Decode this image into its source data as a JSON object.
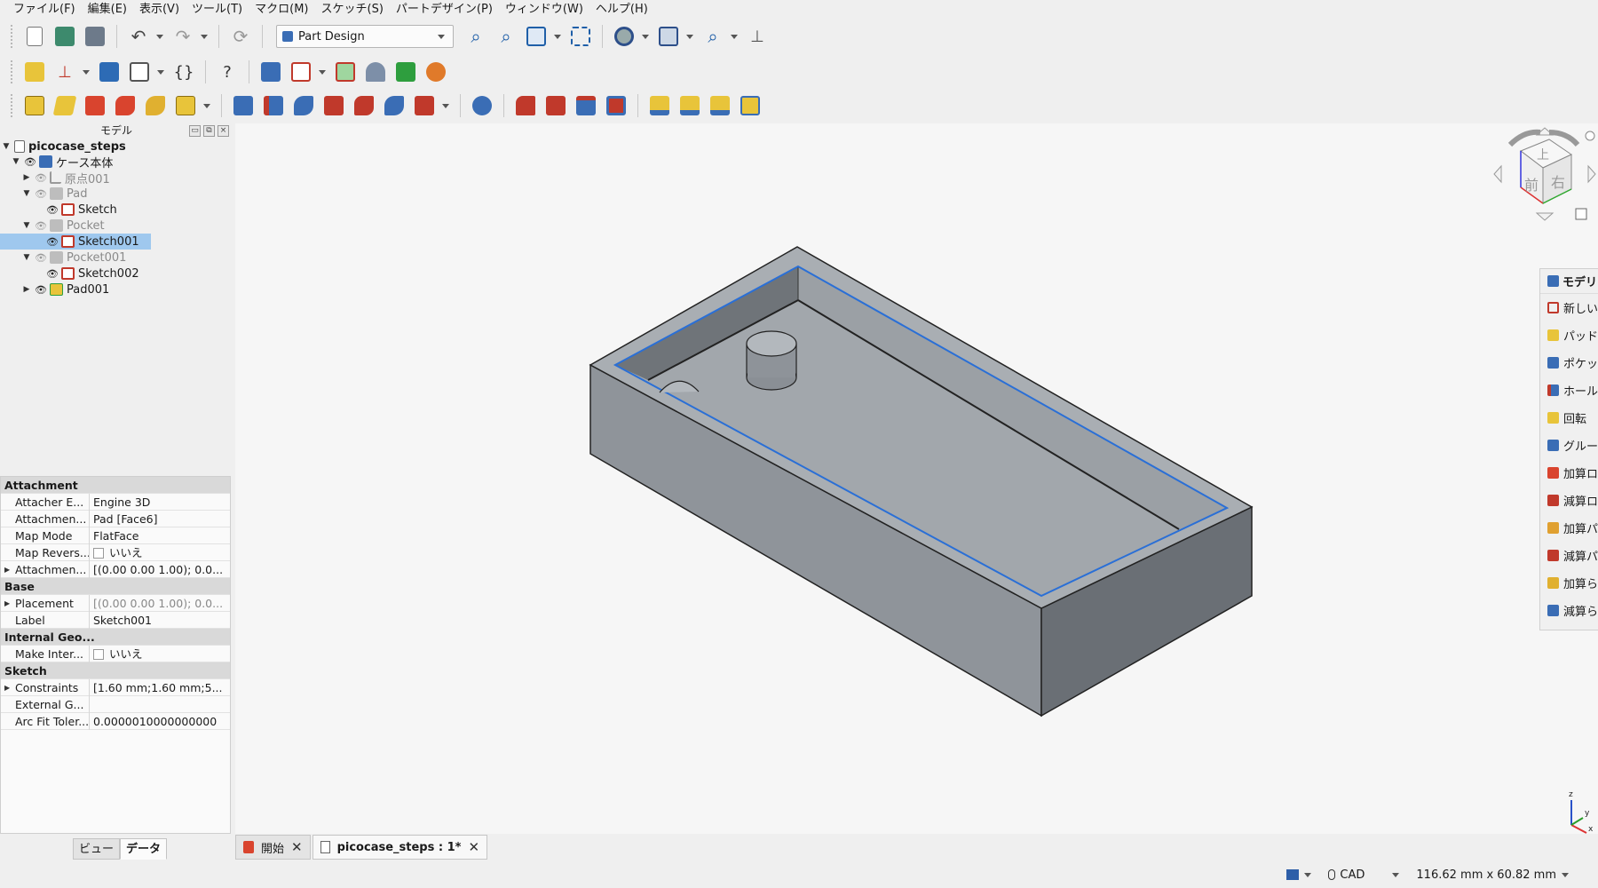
{
  "menu": [
    "ファイル(F)",
    "編集(E)",
    "表示(V)",
    "ツール(T)",
    "マクロ(M)",
    "スケッチ(S)",
    "パートデザイン(P)",
    "ウィンドウ(W)",
    "ヘルプ(H)"
  ],
  "workbench": {
    "selected": "Part Design"
  },
  "tree": {
    "header": "モデル",
    "root": "picocase_steps",
    "body": "ケース本体",
    "origin": "原点001",
    "pad": "Pad",
    "pad_sketch": "Sketch",
    "pocket": "Pocket",
    "pocket_sketch": "Sketch001",
    "pocket001": "Pocket001",
    "pocket001_sketch": "Sketch002",
    "pad001": "Pad001"
  },
  "properties": {
    "groups": {
      "attachment": "Attachment",
      "base": "Base",
      "internal": "Internal Geo...",
      "sketch": "Sketch"
    },
    "rows": {
      "attacher_engine": {
        "name": "Attacher E...",
        "value": "Engine 3D"
      },
      "attachment_support": {
        "name": "Attachmen...",
        "value": "Pad [Face6]"
      },
      "map_mode": {
        "name": "Map Mode",
        "value": "FlatFace"
      },
      "map_reversed": {
        "name": "Map Revers...",
        "value": "いいえ"
      },
      "attachment_offset": {
        "name": "Attachmen...",
        "value": "[(0.00 0.00 1.00); 0.0..."
      },
      "placement": {
        "name": "Placement",
        "value": "[(0.00 0.00 1.00); 0.0..."
      },
      "label": {
        "name": "Label",
        "value": "Sketch001"
      },
      "make_internals": {
        "name": "Make Inter...",
        "value": "いいえ"
      },
      "constraints": {
        "name": "Constraints",
        "value": "[1.60 mm;1.60 mm;5..."
      },
      "external_geo": {
        "name": "External G...",
        "value": ""
      },
      "arc_fit": {
        "name": "Arc Fit Toler...",
        "value": "0.0000010000000000"
      }
    }
  },
  "bottom_tabs": {
    "view": "ビュー",
    "data": "データ"
  },
  "doc_tabs": {
    "start": "開始",
    "doc": "picocase_steps : 1*"
  },
  "navcube": {
    "top": "上",
    "front": "前",
    "right": "右"
  },
  "axes": {
    "x": "x",
    "y": "y",
    "z": "z"
  },
  "right_dock": {
    "title": "モデリ",
    "items": [
      "新しい",
      "パッド",
      "ポケッ",
      "ホール",
      "回転",
      "グルー",
      "加算ロ",
      "減算ロ",
      "加算パ",
      "減算パ",
      "加算ら",
      "減算ら"
    ]
  },
  "status": {
    "nav": "CAD",
    "dimensions": "116.62 mm x 60.82 mm"
  },
  "colors": {
    "selection": "#9fc8ee",
    "box_side": "#8f949a",
    "box_top": "#b5babf",
    "edge_highlight": "#2a6fd6"
  }
}
